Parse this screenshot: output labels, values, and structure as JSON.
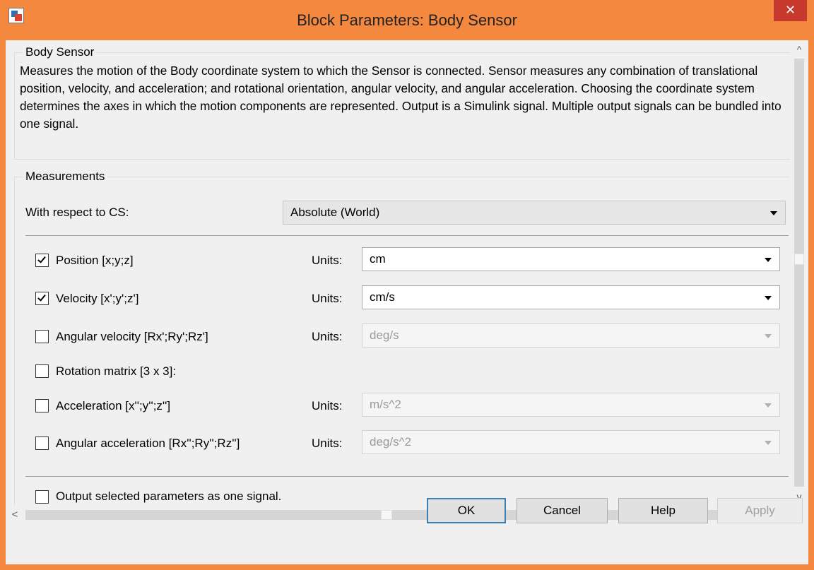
{
  "window": {
    "title": "Block Parameters: Body Sensor",
    "close_glyph": "✕",
    "app_icon": "simulink-block-icon"
  },
  "header": {
    "group_title": "Body Sensor",
    "description": "Measures the motion of the Body coordinate system to which the Sensor is connected. Sensor measures any combination of translational position, velocity, and acceleration; and rotational orientation, angular velocity, and angular acceleration. Choosing the coordinate system determines the axes in which the motion components are represented. Output is a Simulink signal. Multiple output signals can be bundled into one signal."
  },
  "measurements": {
    "group_title": "Measurements",
    "cs_label": "With respect to CS:",
    "cs_value": "Absolute (World)",
    "units_label": "Units:",
    "rows": [
      {
        "label": "Position [x;y;z]",
        "checked": true,
        "units": "cm",
        "enabled": true
      },
      {
        "label": "Velocity [x';y';z']",
        "checked": true,
        "units": "cm/s",
        "enabled": true
      },
      {
        "label": "Angular velocity [Rx';Ry';Rz']",
        "checked": false,
        "units": "deg/s",
        "enabled": false
      },
      {
        "label": "Rotation matrix [3 x 3]:",
        "checked": false
      },
      {
        "label": "Acceleration [x'';y'';z'']",
        "checked": false,
        "units": "m/s^2",
        "enabled": false
      },
      {
        "label": "Angular acceleration [Rx'';Ry'';Rz'']",
        "checked": false,
        "units": "deg/s^2",
        "enabled": false
      }
    ],
    "output_one_signal": {
      "label": "Output selected parameters as one signal.",
      "checked": false
    }
  },
  "scrollbars": {
    "up": "^",
    "down": "v",
    "left": "<",
    "right": ">"
  },
  "buttons": {
    "ok": "OK",
    "cancel": "Cancel",
    "help": "Help",
    "apply": "Apply"
  }
}
